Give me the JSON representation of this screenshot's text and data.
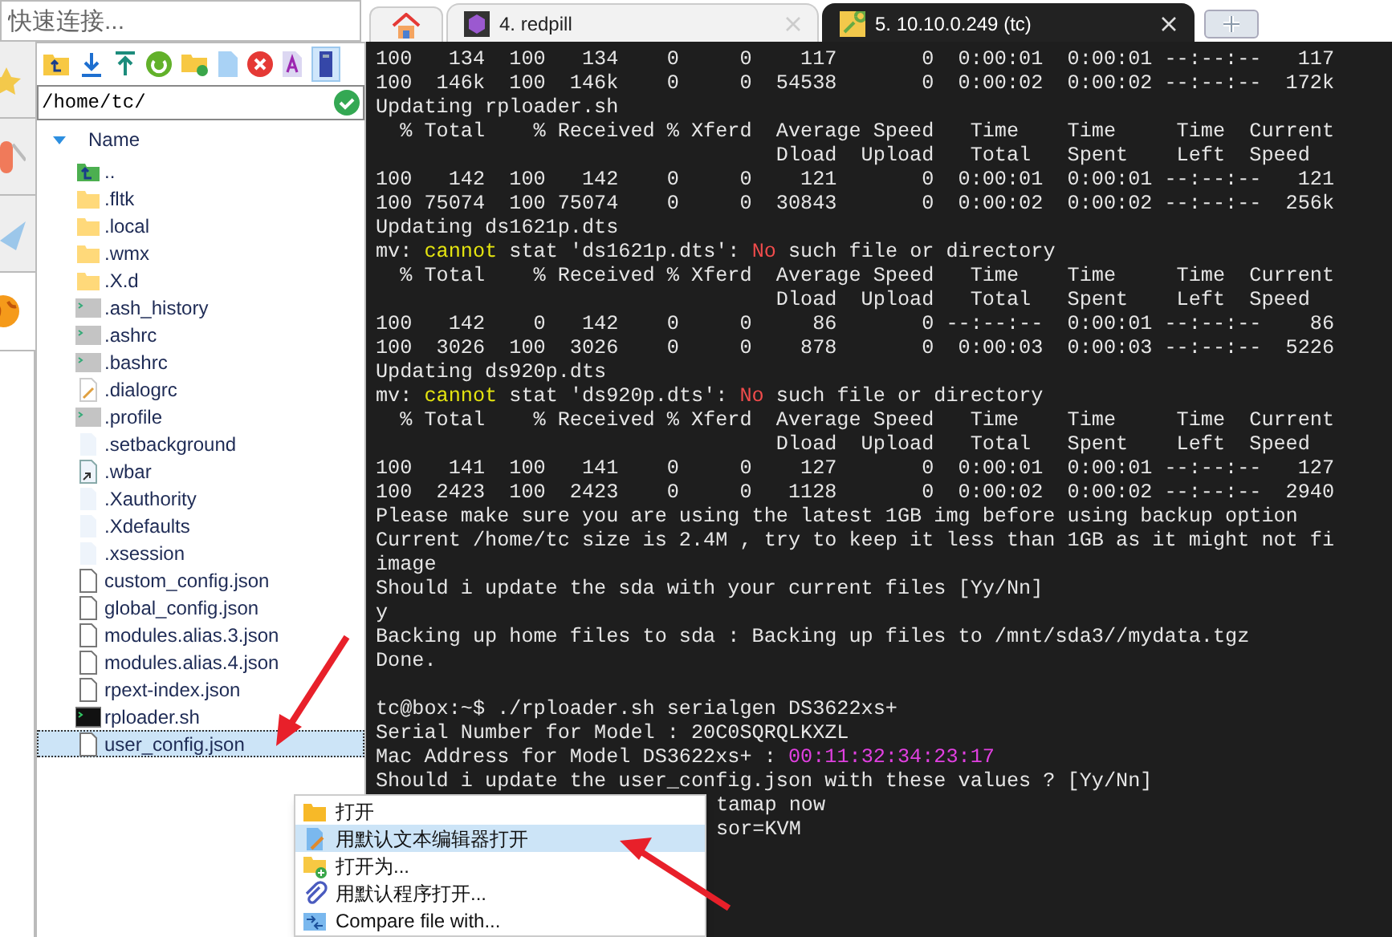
{
  "quick_connect": {
    "placeholder": "快速连接..."
  },
  "file_panel": {
    "path": "/home/tc/",
    "column": "Name",
    "files": [
      {
        "name": "..",
        "kind": "up",
        "selected": false
      },
      {
        "name": ".fltk",
        "kind": "folder",
        "selected": false
      },
      {
        "name": ".local",
        "kind": "folder",
        "selected": false
      },
      {
        "name": ".wmx",
        "kind": "folder",
        "selected": false
      },
      {
        "name": ".X.d",
        "kind": "folder",
        "selected": false
      },
      {
        "name": ".ash_history",
        "kind": "shell",
        "selected": false
      },
      {
        "name": ".ashrc",
        "kind": "shell",
        "selected": false
      },
      {
        "name": ".bashrc",
        "kind": "shell",
        "selected": false
      },
      {
        "name": ".dialogrc",
        "kind": "note",
        "selected": false
      },
      {
        "name": ".profile",
        "kind": "shell",
        "selected": false
      },
      {
        "name": ".setbackground",
        "kind": "blank",
        "selected": false
      },
      {
        "name": ".wbar",
        "kind": "link",
        "selected": false
      },
      {
        "name": ".Xauthority",
        "kind": "blank",
        "selected": false
      },
      {
        "name": ".Xdefaults",
        "kind": "blank",
        "selected": false
      },
      {
        "name": ".xsession",
        "kind": "blank",
        "selected": false
      },
      {
        "name": "custom_config.json",
        "kind": "doc",
        "selected": false
      },
      {
        "name": "global_config.json",
        "kind": "doc",
        "selected": false
      },
      {
        "name": "modules.alias.3.json",
        "kind": "doc",
        "selected": false
      },
      {
        "name": "modules.alias.4.json",
        "kind": "doc",
        "selected": false
      },
      {
        "name": "rpext-index.json",
        "kind": "doc",
        "selected": false
      },
      {
        "name": "rploader.sh",
        "kind": "script",
        "selected": false
      },
      {
        "name": "user_config.json",
        "kind": "doc",
        "selected": true
      }
    ]
  },
  "tabs": [
    {
      "kind": "home",
      "selected": false
    },
    {
      "kind": "session",
      "label": "4. redpill",
      "selected": false
    },
    {
      "kind": "session",
      "label": "5. 10.10.0.249 (tc)",
      "selected": true
    }
  ],
  "terminal": {
    "lines": [
      [
        {
          "text": "100   134  100   134    0     0    117       0  0:00:01  0:00:01 --:--:--   117"
        }
      ],
      [
        {
          "text": "100  146k  100  146k    0     0  54538       0  0:00:02  0:00:02 --:--:--  172k"
        }
      ],
      [
        {
          "text": "Updating rploader.sh"
        }
      ],
      [
        {
          "text": "  % Total    % Received % Xferd  Average Speed   Time    Time     Time  Current"
        }
      ],
      [
        {
          "text": "                                 Dload  Upload   Total   Spent    Left  Speed"
        }
      ],
      [
        {
          "text": "100   142  100   142    0     0    121       0  0:00:01  0:00:01 --:--:--   121"
        }
      ],
      [
        {
          "text": "100 75074  100 75074    0     0  30843       0  0:00:02  0:00:02 --:--:--  256k"
        }
      ],
      [
        {
          "text": "Updating ds1621p.dts"
        }
      ],
      [
        {
          "text": "mv: "
        },
        {
          "text": "cannot",
          "kind": "warn"
        },
        {
          "text": " stat 'ds1621p.dts': "
        },
        {
          "text": "No",
          "kind": "error"
        },
        {
          "text": " such file or directory"
        }
      ],
      [
        {
          "text": "  % Total    % Received % Xferd  Average Speed   Time    Time     Time  Current"
        }
      ],
      [
        {
          "text": "                                 Dload  Upload   Total   Spent    Left  Speed"
        }
      ],
      [
        {
          "text": "100   142    0   142    0     0     86       0 --:--:--  0:00:01 --:--:--    86"
        }
      ],
      [
        {
          "text": "100  3026  100  3026    0     0    878       0  0:00:03  0:00:03 --:--:--  5226"
        }
      ],
      [
        {
          "text": "Updating ds920p.dts"
        }
      ],
      [
        {
          "text": "mv: "
        },
        {
          "text": "cannot",
          "kind": "warn"
        },
        {
          "text": " stat 'ds920p.dts': "
        },
        {
          "text": "No",
          "kind": "error"
        },
        {
          "text": " such file or directory"
        }
      ],
      [
        {
          "text": "  % Total    % Received % Xferd  Average Speed   Time    Time     Time  Current"
        }
      ],
      [
        {
          "text": "                                 Dload  Upload   Total   Spent    Left  Speed"
        }
      ],
      [
        {
          "text": "100   141  100   141    0     0    127       0  0:00:01  0:00:01 --:--:--   127"
        }
      ],
      [
        {
          "text": "100  2423  100  2423    0     0   1128       0  0:00:02  0:00:02 --:--:--  2940"
        }
      ],
      [
        {
          "text": "Please make sure you are using the latest 1GB img before using backup option"
        }
      ],
      [
        {
          "text": "Current /home/tc size is 2.4M , try to keep it less than 1GB as it might not fi"
        }
      ],
      [
        {
          "text": "image"
        }
      ],
      [
        {
          "text": "Should i update the sda with your current files [Yy/Nn]"
        }
      ],
      [
        {
          "text": "y"
        }
      ],
      [
        {
          "text": "Backing up home files to sda : Backing up files to /mnt/sda3//mydata.tgz"
        }
      ],
      [
        {
          "text": "Done."
        }
      ],
      [
        {
          "text": "tc@box:~$ ./rploader.sh serialgen DS3622xs+",
          "kind": "prompt"
        }
      ],
      [
        {
          "text": "Serial Number for Model : 20C0SQRQLKXZL"
        }
      ],
      [
        {
          "text": "Mac Address for Model DS3622xs+ : "
        },
        {
          "text": "00:11:32:34:23:17",
          "kind": "address"
        }
      ],
      [
        {
          "text": "Should i update the user_config.json with these values ? [Yy/Nn]"
        }
      ],
      [
        {
          "text": "tamap now",
          "kind": "covered"
        }
      ],
      [
        {
          "text": "sor=KVM",
          "kind": "covered"
        }
      ]
    ]
  },
  "context_menu": [
    {
      "label": "打开",
      "kind": "folder",
      "selected": false
    },
    {
      "label": "用默认文本编辑器打开",
      "kind": "edit",
      "selected": true
    },
    {
      "label": "打开为...",
      "kind": "folder-add",
      "selected": false
    },
    {
      "label": "用默认程序打开...",
      "kind": "clip",
      "selected": false
    },
    {
      "label": "Compare file with...",
      "kind": "compare",
      "selected": false
    }
  ]
}
